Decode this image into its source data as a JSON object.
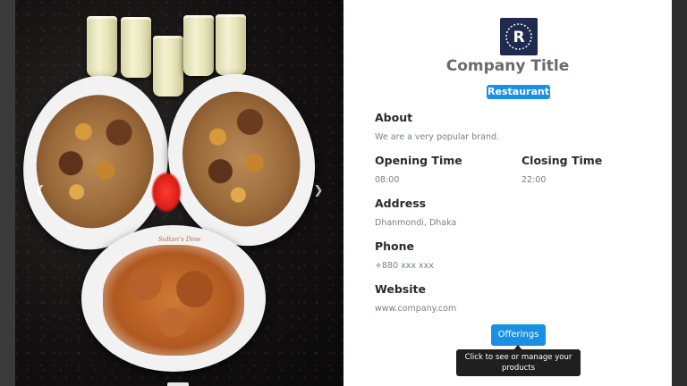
{
  "gallery": {
    "plate_inscription": "Sultan's Dine",
    "prev_icon": "chevron-left-icon",
    "next_icon": "chevron-right-icon"
  },
  "profile": {
    "logo_letter": "R",
    "title": "Company Title",
    "category": "Restaurant",
    "about": {
      "label": "About",
      "value": "We are a very popular brand."
    },
    "opening": {
      "label": "Opening Time",
      "value": "08:00"
    },
    "closing": {
      "label": "Closing Time",
      "value": "22:00"
    },
    "address": {
      "label": "Address",
      "value": "Dhanmondi, Dhaka"
    },
    "phone": {
      "label": "Phone",
      "value": "+880 xxx xxx"
    },
    "website": {
      "label": "Website",
      "value": "www.company.com"
    },
    "offerings_button": "Offerings",
    "tooltip": "Click to see or manage your products"
  },
  "colors": {
    "accent": "#1a8fe3",
    "logo_bg": "#1e2a4e",
    "title": "#666b70"
  }
}
